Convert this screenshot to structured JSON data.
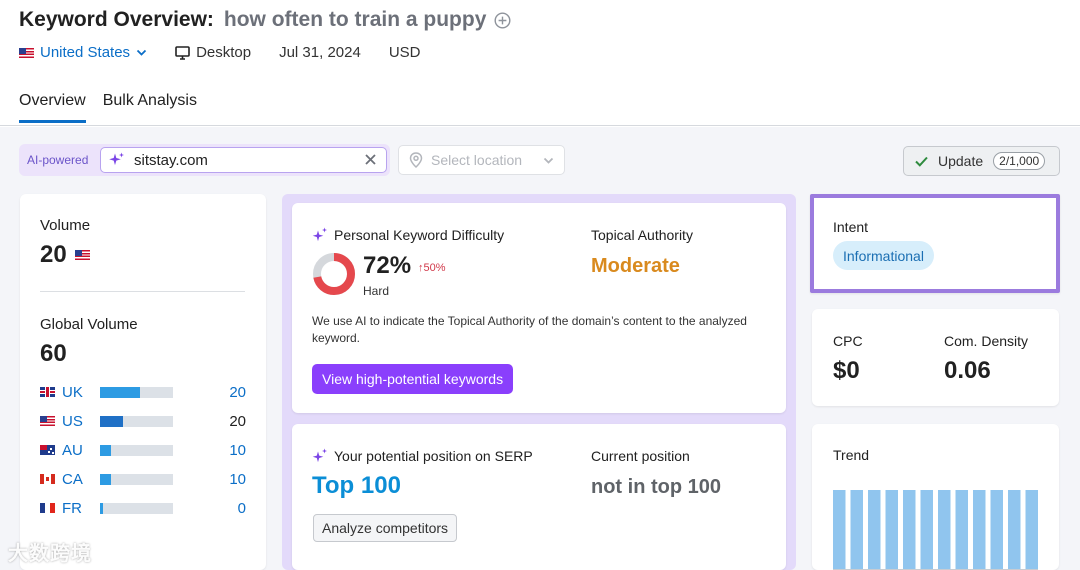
{
  "header": {
    "title": "Keyword Overview:",
    "keyword": "how often to train a puppy",
    "country": "United States",
    "device": "Desktop",
    "date": "Jul 31, 2024",
    "currency": "USD"
  },
  "tabs": [
    {
      "label": "Overview",
      "active": true
    },
    {
      "label": "Bulk Analysis",
      "active": false
    }
  ],
  "toolbar": {
    "ai_label": "AI-powered",
    "domain_value": "sitstay.com",
    "location_placeholder": "Select location",
    "update_label": "Update",
    "update_quota": "2/1,000"
  },
  "volume": {
    "label": "Volume",
    "value": "20",
    "global_label": "Global Volume",
    "global_value": "60",
    "countries": [
      {
        "code": "UK",
        "count": "20",
        "share": 0.55
      },
      {
        "code": "US",
        "count": "20",
        "share": 0.32
      },
      {
        "code": "AU",
        "count": "10",
        "share": 0.15
      },
      {
        "code": "CA",
        "count": "10",
        "share": 0.15
      },
      {
        "code": "FR",
        "count": "0",
        "share": 0.04
      }
    ]
  },
  "difficulty": {
    "title": "Personal Keyword Difficulty",
    "value": "72%",
    "delta": "↑50%",
    "level": "Hard",
    "fraction": 0.72,
    "authority_label": "Topical Authority",
    "authority_value": "Moderate",
    "note": "We use AI to indicate the Topical Authority of the domain’s content to the analyzed keyword.",
    "button": "View high-potential keywords"
  },
  "serp": {
    "title": "Your potential position on SERP",
    "value": "Top 100",
    "current_label": "Current position",
    "current_value": "not in top 100",
    "button": "Analyze competitors"
  },
  "intent": {
    "label": "Intent",
    "value": "Informational"
  },
  "cpc": {
    "label": "CPC",
    "value": "$0",
    "density_label": "Com. Density",
    "density_value": "0.06"
  },
  "trend": {
    "label": "Trend",
    "values": [
      1,
      1,
      1,
      1,
      1,
      1,
      1,
      1,
      1,
      1,
      1,
      1
    ]
  },
  "watermark": "大数跨境",
  "colors": {
    "accent": "#0b6ec7",
    "purple": "#8a3ffc",
    "bar": "#2d9be3",
    "trend": "#90c5ee",
    "difficulty": "#e5484d",
    "authority": "#d98a1e"
  }
}
